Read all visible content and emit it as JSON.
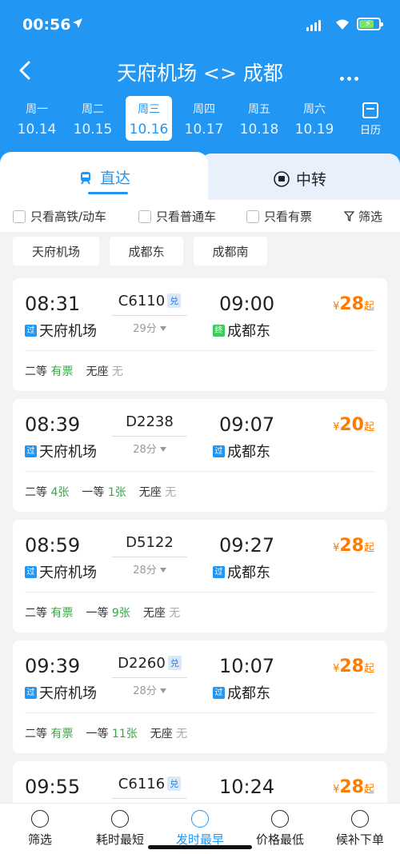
{
  "status_bar": {
    "time": "00:56"
  },
  "header": {
    "title": "天府机场 <> 成都",
    "dates": [
      {
        "weekday": "周一",
        "date": "10.14",
        "active": false
      },
      {
        "weekday": "周二",
        "date": "10.15",
        "active": false
      },
      {
        "weekday": "周三",
        "date": "10.16",
        "active": true
      },
      {
        "weekday": "周四",
        "date": "10.17",
        "active": false
      },
      {
        "weekday": "周五",
        "date": "10.18",
        "active": false
      },
      {
        "weekday": "周六",
        "date": "10.19",
        "active": false
      }
    ],
    "calendar_label": "日历"
  },
  "tabs": {
    "direct": "直达",
    "transfer": "中转"
  },
  "filters": {
    "high_speed": "只看高铁/动车",
    "regular": "只看普通车",
    "available": "只看有票",
    "filter": "筛选"
  },
  "stations": [
    "天府机场",
    "成都东",
    "成都南"
  ],
  "trains": [
    {
      "dep_time": "08:31",
      "train_no": "C6110",
      "dui": "兑",
      "duration": "29分",
      "arr_time": "09:00",
      "dep_station": "天府机场",
      "dep_tag": "过",
      "arr_station": "成都东",
      "arr_tag": "终",
      "price_symbol": "¥",
      "price": "28",
      "price_suffix": "起",
      "seats": [
        {
          "label": "二等",
          "value": "有票",
          "available": true
        },
        {
          "label": "无座",
          "value": "无",
          "available": false
        }
      ]
    },
    {
      "dep_time": "08:39",
      "train_no": "D2238",
      "dui": "",
      "duration": "28分",
      "arr_time": "09:07",
      "dep_station": "天府机场",
      "dep_tag": "过",
      "arr_station": "成都东",
      "arr_tag": "过",
      "price_symbol": "¥",
      "price": "20",
      "price_suffix": "起",
      "seats": [
        {
          "label": "二等",
          "value": "4张",
          "available": true
        },
        {
          "label": "一等",
          "value": "1张",
          "available": true
        },
        {
          "label": "无座",
          "value": "无",
          "available": false
        }
      ]
    },
    {
      "dep_time": "08:59",
      "train_no": "D5122",
      "dui": "",
      "duration": "28分",
      "arr_time": "09:27",
      "dep_station": "天府机场",
      "dep_tag": "过",
      "arr_station": "成都东",
      "arr_tag": "过",
      "price_symbol": "¥",
      "price": "28",
      "price_suffix": "起",
      "seats": [
        {
          "label": "二等",
          "value": "有票",
          "available": true
        },
        {
          "label": "一等",
          "value": "9张",
          "available": true
        },
        {
          "label": "无座",
          "value": "无",
          "available": false
        }
      ]
    },
    {
      "dep_time": "09:39",
      "train_no": "D2260",
      "dui": "兑",
      "duration": "28分",
      "arr_time": "10:07",
      "dep_station": "天府机场",
      "dep_tag": "过",
      "arr_station": "成都东",
      "arr_tag": "过",
      "price_symbol": "¥",
      "price": "28",
      "price_suffix": "起",
      "seats": [
        {
          "label": "二等",
          "value": "有票",
          "available": true
        },
        {
          "label": "一等",
          "value": "11张",
          "available": true
        },
        {
          "label": "无座",
          "value": "无",
          "available": false
        }
      ]
    },
    {
      "dep_time": "09:55",
      "train_no": "C6116",
      "dui": "兑",
      "duration": "",
      "arr_time": "10:24",
      "dep_station": "",
      "dep_tag": "",
      "arr_station": "",
      "arr_tag": "",
      "price_symbol": "¥",
      "price": "28",
      "price_suffix": "起",
      "seats": []
    }
  ],
  "bottom_bar": [
    {
      "label": "筛选",
      "icon": "filter-icon",
      "active": false
    },
    {
      "label": "耗时最短",
      "icon": "timer-icon",
      "active": false
    },
    {
      "label": "发时最早",
      "icon": "clock-24-icon",
      "active": true
    },
    {
      "label": "价格最低",
      "icon": "price-tag-icon",
      "active": false
    },
    {
      "label": "候补下单",
      "icon": "cart-icon",
      "active": false
    }
  ],
  "colors": {
    "primary": "#2196f3",
    "price": "#ff7b00",
    "available": "#3aa545"
  }
}
